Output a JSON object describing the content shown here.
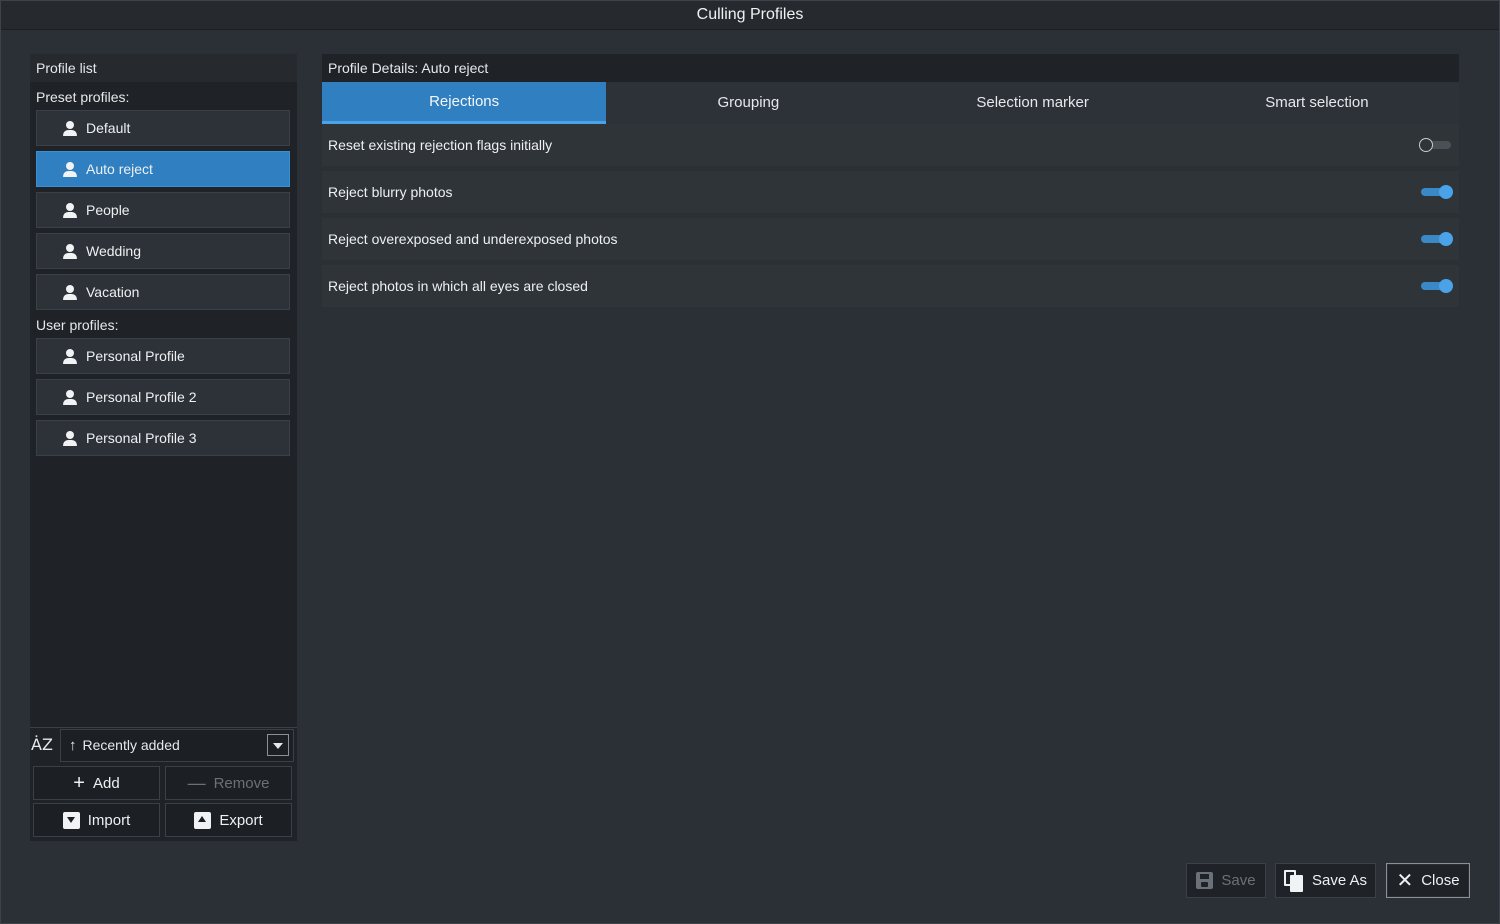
{
  "window": {
    "title": "Culling Profiles"
  },
  "left_panel": {
    "header": "Profile list",
    "preset_label": "Preset profiles:",
    "preset_profiles": [
      "Default",
      "Auto reject",
      "People",
      "Wedding",
      "Vacation"
    ],
    "selected_profile": "Auto reject",
    "user_label": "User profiles:",
    "user_profiles": [
      "Personal Profile",
      "Personal Profile 2",
      "Personal Profile 3"
    ],
    "sort": {
      "icon": "az-sort-icon",
      "text": "ȦZ",
      "value": "Recently added"
    },
    "buttons": {
      "add": "Add",
      "remove": "Remove",
      "import": "Import",
      "export": "Export"
    }
  },
  "details": {
    "header": "Profile Details: Auto reject",
    "tabs": [
      "Rejections",
      "Grouping",
      "Selection marker",
      "Smart selection"
    ],
    "active_tab": "Rejections",
    "settings": [
      {
        "label": "Reset existing rejection flags initially",
        "enabled": false
      },
      {
        "label": "Reject blurry photos",
        "enabled": true
      },
      {
        "label": "Reject overexposed and underexposed photos",
        "enabled": true
      },
      {
        "label": "Reject photos in which all eyes are closed",
        "enabled": true
      }
    ]
  },
  "footer": {
    "save": "Save",
    "save_as": "Save As",
    "close": "Close"
  },
  "colors": {
    "accent": "#2f7fc1",
    "background": "#2b3036",
    "panel": "#1f2327"
  }
}
